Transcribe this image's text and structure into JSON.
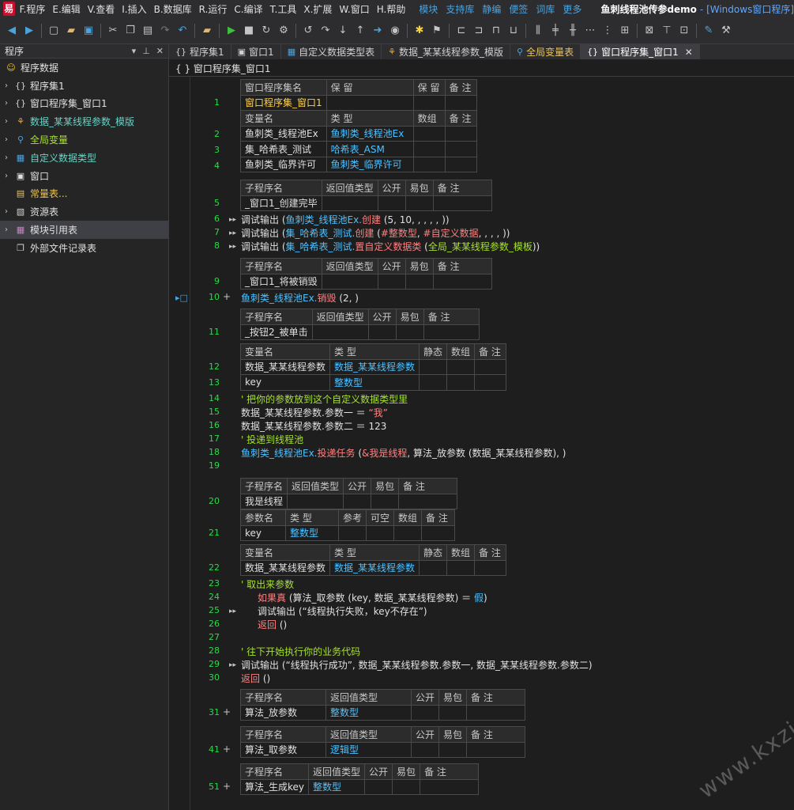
{
  "menubar": {
    "items": [
      "F.程序",
      "E.编辑",
      "V.查看",
      "I.插入",
      "B.数据库",
      "R.运行",
      "C.编译",
      "T.工具",
      "X.扩展",
      "W.窗口",
      "H.帮助"
    ],
    "links": [
      "模块",
      "支持库",
      "静编",
      "便签",
      "词库",
      "更多"
    ],
    "title": "鱼刺线程池传参demo",
    "title_suffix": "- [Windows窗口程序]"
  },
  "left_panel": {
    "title": "程序",
    "items": [
      {
        "label": "程序数据",
        "icon": "smiley-icon",
        "color": "#e0e0e0"
      },
      {
        "label": "程序集1",
        "icon": "braces-icon",
        "color": "#e0e0e0"
      },
      {
        "label": "窗口程序集_窗口1",
        "icon": "braces-icon",
        "color": "#e0e0e0"
      },
      {
        "label": "数据_某某线程参数_模版",
        "icon": "datatype-icon",
        "color": "#6ad1c4"
      },
      {
        "label": "全局变量",
        "icon": "global-var-icon",
        "color": "#a6e22e"
      },
      {
        "label": "自定义数据类型",
        "icon": "table-icon",
        "color": "#6ad1c4"
      },
      {
        "label": "窗口",
        "icon": "window-icon",
        "color": "#e0e0e0"
      },
      {
        "label": "常量表...",
        "icon": "constant-icon",
        "color": "#e8c35a"
      },
      {
        "label": "资源表",
        "icon": "resource-icon",
        "color": "#e0e0e0"
      },
      {
        "label": "模块引用表",
        "icon": "module-icon",
        "color": "#e0e0e0"
      },
      {
        "label": "外部文件记录表",
        "icon": "file-icon",
        "color": "#e0e0e0"
      }
    ]
  },
  "tabs": [
    {
      "label": "程序集1",
      "icon": "braces-icon"
    },
    {
      "label": "窗口1",
      "icon": "window-icon"
    },
    {
      "label": "自定义数据类型表",
      "icon": "table-icon"
    },
    {
      "label": "数据_某某线程参数_模版",
      "icon": "datatype-icon"
    },
    {
      "label": "全局变量表",
      "icon": "global-var-icon"
    },
    {
      "label": "窗口程序集_窗口1",
      "icon": "braces-icon"
    }
  ],
  "breadcrumb": "{ } 窗口程序集_窗口1",
  "editor": {
    "line_numbers": [
      "1",
      "2",
      "3",
      "4",
      "5",
      "6",
      "7",
      "8",
      "9",
      "10",
      "11",
      "12",
      "13",
      "14",
      "15",
      "16",
      "17",
      "18",
      "19",
      "20",
      "21",
      "22",
      "23",
      "24",
      "25",
      "26",
      "27",
      "28",
      "29",
      "30",
      "31",
      "41",
      "51"
    ],
    "t1": {
      "h": [
        "窗口程序集名",
        "保 留",
        "保 留",
        "备 注"
      ],
      "r": [
        "窗口程序集_窗口1",
        "",
        "",
        ""
      ],
      "vh": [
        "变量名",
        "类 型",
        "数组",
        "备 注"
      ],
      "vars": [
        [
          "鱼刺类_线程池Ex",
          "鱼刺类_线程池Ex",
          "",
          ""
        ],
        [
          "集_哈希表_测试",
          "哈希表_ASM",
          "",
          ""
        ],
        [
          "鱼刺类_临界许可",
          "鱼刺类_临界许可",
          "",
          ""
        ]
      ]
    },
    "sub_h": [
      "子程序名",
      "返回值类型",
      "公开",
      "易包",
      "备 注"
    ],
    "sub1": "_窗口1_创建完毕",
    "sub2": "_窗口1_将被销毁",
    "sub3": "_按钮2_被单击",
    "lv_h": [
      "变量名",
      "类 型",
      "静态",
      "数组",
      "备 注"
    ],
    "lv1": [
      [
        "数据_某某线程参数",
        "数据_某某线程参数",
        "",
        "",
        ""
      ],
      [
        "key",
        "整数型",
        "",
        "",
        ""
      ]
    ],
    "sub4": "我是线程",
    "par_h": [
      "参数名",
      "类 型",
      "参考",
      "可空",
      "数组",
      "备 注"
    ],
    "par1": [
      "key",
      "整数型",
      "",
      "",
      "",
      ""
    ],
    "lv2": [
      "数据_某某线程参数",
      "数据_某某线程参数",
      "",
      "",
      ""
    ],
    "sub5": [
      "算法_放参数",
      "整数型"
    ],
    "sub6": [
      "算法_取参数",
      "逻辑型"
    ],
    "sub7": [
      "算法_生成key",
      "整数型"
    ],
    "code": {
      "l6": [
        "调试输出 (",
        "鱼刺类_线程池Ex.",
        "创建",
        " (5, 10, , , , , ))"
      ],
      "l7": [
        "调试输出 (",
        "集_哈希表_测试.",
        "创建",
        " (",
        "#整数型",
        ", ",
        "#自定义数据",
        ", , , , ))"
      ],
      "l8": [
        "调试输出 (",
        "集_哈希表_测试.",
        "置自定义数据类",
        " (",
        "全局_某某线程参数_模板",
        "))"
      ],
      "l10": [
        "鱼刺类_线程池Ex.",
        "销毁",
        " (2, )"
      ],
      "l14": "' 把你的参数放到这个自定义数据类型里",
      "l15": [
        "数据_某某线程参数.参数一 ＝ ",
        "“我”"
      ],
      "l16": "数据_某某线程参数.参数二 ＝ 123",
      "l17": "' 投递到线程池",
      "l18": [
        "鱼刺类_线程池Ex.",
        "投递任务",
        " (",
        "&我是线程",
        ", 算法_放参数 (数据_某某线程参数), )"
      ],
      "l23": "' 取出来参数",
      "l24": [
        "如果真",
        " (算法_取参数 (key, 数据_某某线程参数) ＝ ",
        "假",
        ")"
      ],
      "l25": "调试输出 (“线程执行失败，key不存在”)",
      "l26": [
        "返回",
        " ()"
      ],
      "l28": "' 往下开始执行你的业务代码",
      "l29": "调试输出 (“线程执行成功”, 数据_某某线程参数.参数一, 数据_某某线程参数.参数二)",
      "l30": [
        "返回",
        " ()"
      ]
    }
  },
  "watermark": "www.kxzi.cn"
}
